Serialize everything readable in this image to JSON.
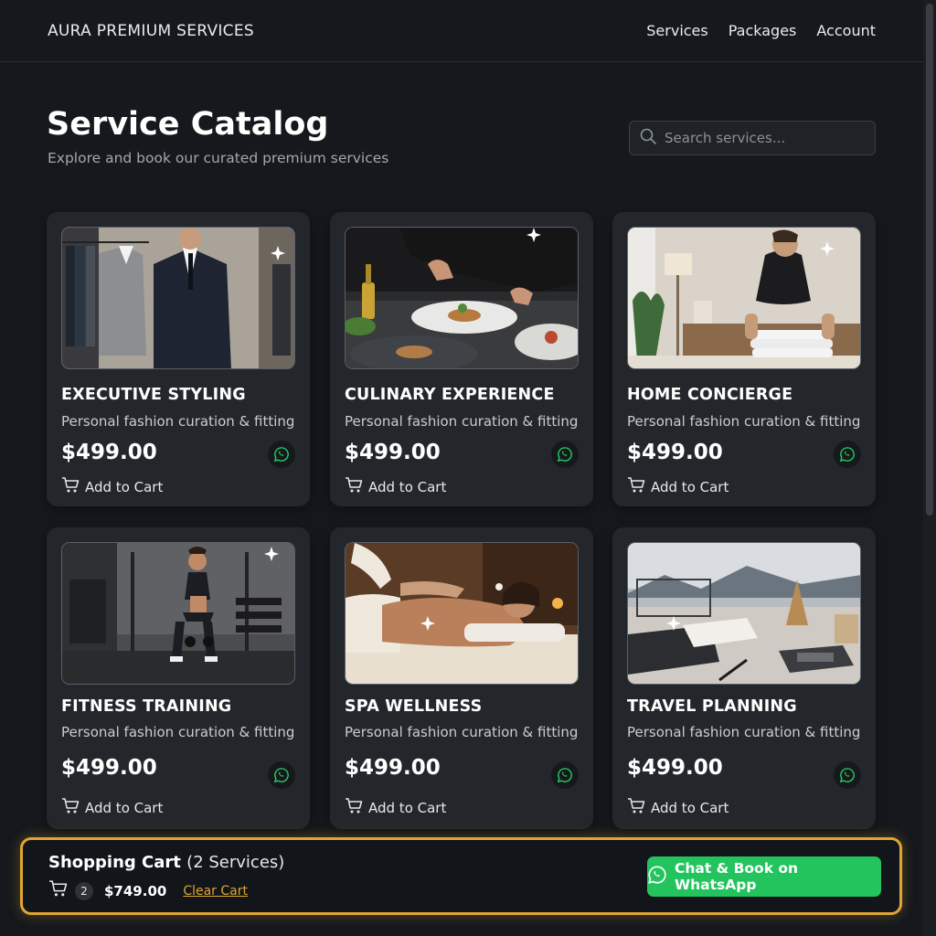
{
  "header": {
    "brand": "AURA PREMIUM SERVICES",
    "nav": [
      "Services",
      "Packages",
      "Account"
    ]
  },
  "main": {
    "title": "Service Catalog",
    "subtitle": "Explore and book our curated premium services",
    "search_placeholder": "Search services..."
  },
  "services": [
    {
      "title": "EXECUTIVE STYLING",
      "description": "Personal fashion curation & fitting",
      "price": "$499.00",
      "add_label": "Add to Cart",
      "image": "tailored-suits-photo"
    },
    {
      "title": "CULINARY EXPERIENCE",
      "description": "Personal fashion curation & fitting",
      "price": "$499.00",
      "add_label": "Add to Cart",
      "image": "chef-plating-photo"
    },
    {
      "title": "HOME CONCIERGE",
      "description": "Personal fashion curation & fitting",
      "price": "$499.00",
      "add_label": "Add to Cart",
      "image": "housekeeper-towels-photo"
    },
    {
      "title": "FITNESS TRAINING",
      "description": "Personal fashion curation & fitting",
      "price": "$499.00",
      "add_label": "Add to Cart",
      "image": "gym-squat-photo"
    },
    {
      "title": "SPA WELLNESS",
      "description": "Personal fashion curation & fitting",
      "price": "$499.00",
      "add_label": "Add to Cart",
      "image": "massage-photo"
    },
    {
      "title": "TRAVEL PLANNING",
      "description": "Personal fashion curation & fitting",
      "price": "$499.00",
      "add_label": "Add to Cart",
      "image": "travel-desk-photo"
    }
  ],
  "cart": {
    "title": "Shopping Cart",
    "count_text": "(2 Services)",
    "badge": "2",
    "total": "$749.00",
    "clear_label": "Clear Cart",
    "whatsapp_label": "Chat & Book on WhatsApp"
  },
  "colors": {
    "background": "#15181c",
    "card": "#23272c",
    "accent_gold": "#e0a534",
    "whatsapp_green": "#23c45e"
  },
  "icons": [
    "search-icon",
    "whatsapp-icon",
    "cart-icon"
  ]
}
